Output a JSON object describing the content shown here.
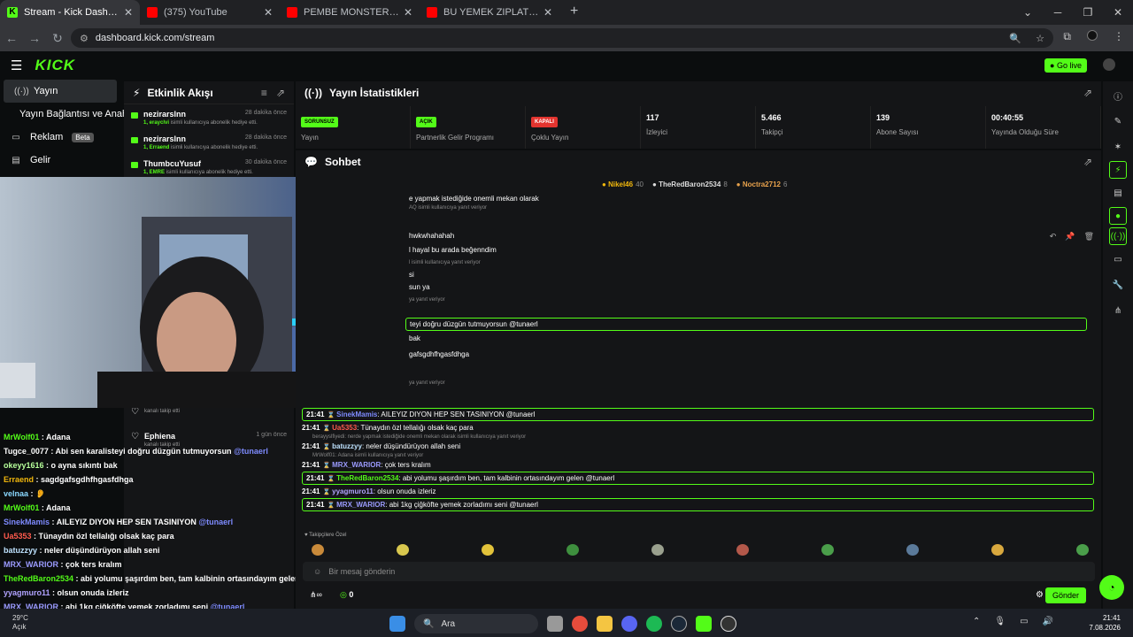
{
  "browser": {
    "tabs": [
      {
        "label": "Stream - Kick Dashboard",
        "icon": "kick-favicon"
      },
      {
        "label": "(375) YouTube",
        "icon": "youtube-favicon"
      },
      {
        "label": "PEMBE MONSTER | Madara Olu...",
        "icon": "youtube-favicon"
      },
      {
        "label": "BU YEMEK ZIPLATIRI ELRAEN, E...",
        "icon": "youtube-favicon"
      }
    ],
    "url": "dashboard.kick.com/stream"
  },
  "header": {
    "logo": "KICK",
    "go_live": "Go live"
  },
  "sidebar": {
    "items": [
      {
        "label": "Yayın",
        "icon": "broadcast-icon"
      },
      {
        "label": "Yayın Bağlantısı ve Anahtarı",
        "icon": ""
      },
      {
        "label": "Reklam",
        "badge": "Beta",
        "icon": "ad-icon"
      },
      {
        "label": "Gelir",
        "icon": "revenue-icon"
      }
    ]
  },
  "activity": {
    "title": "Etkinlik Akışı",
    "events": [
      {
        "name": "nezirarslnn",
        "user": "1, erayclvi",
        "desc": " isimli kullanıcıya abonelik hediye etti.",
        "time": "28 dakika önce"
      },
      {
        "name": "nezirarslnn",
        "user": "1, Erraend",
        "desc": " isimli kullanıcıya abonelik hediye etti.",
        "time": "28 dakika önce"
      },
      {
        "name": "ThumbcuYusuf",
        "user": "1, EMRE",
        "desc": " isimli kullanıcıya abonelik hediye etti.",
        "time": "30 dakika önce"
      }
    ],
    "follow_events": [
      {
        "name": "",
        "desc": "kanalı takip etti",
        "time": ""
      },
      {
        "name": "Ephiena",
        "desc": "kanalı takip etti",
        "time": "1 gün önce"
      }
    ]
  },
  "stats": {
    "title": "Yayın İstatistikleri",
    "items": [
      {
        "badge": "SORUNSUZ",
        "label": "Yayın",
        "type": "ok"
      },
      {
        "badge": "AÇIK",
        "label": "Partnerlik Gelir Programı",
        "type": "ok"
      },
      {
        "badge": "KAPALI",
        "label": "Çoklu Yayın",
        "type": "off"
      },
      {
        "value": "117",
        "label": "İzleyici"
      },
      {
        "value": "5.466",
        "label": "Takipçi"
      },
      {
        "value": "139",
        "label": "Abone Sayısı"
      },
      {
        "value": "00:40:55",
        "label": "Yayında Olduğu Süre"
      }
    ]
  },
  "chat": {
    "title": "Sohbet",
    "pinned": [
      {
        "name": "Nikel46",
        "count": "40",
        "color": "#f2b80c"
      },
      {
        "name": "TheRedBaron2534",
        "count": "8",
        "color": "#dddddd"
      },
      {
        "name": "Noctra2712",
        "count": "6",
        "color": "#e8a24c"
      }
    ],
    "hidden_lines": [
      {
        "text": "e yapmak istediğide onemli mekan olarak",
        "kind": "msg"
      },
      {
        "text": "AQ isimli kullanıcıya yanıt veriyor",
        "kind": "reply"
      },
      {
        "text": "hwkwhahahah",
        "kind": "msg"
      },
      {
        "text": "l hayal bu arada beğenndim",
        "kind": "msg"
      },
      {
        "text": "l isimli kullanıcıya yanıt veriyor",
        "kind": "reply"
      },
      {
        "text": "si",
        "kind": "msg"
      },
      {
        "text": "sun ya",
        "kind": "msg"
      },
      {
        "text": "ya yanıt veriyor",
        "kind": "reply"
      },
      {
        "text": "teyi doğru düzgün tutmuyorsun @tunaerl",
        "kind": "hl"
      },
      {
        "text": "bak",
        "kind": "msg"
      },
      {
        "text": "gafsgdhfhgasfdhga",
        "kind": "msg"
      },
      {
        "text": "ya yanıt veriyor",
        "kind": "reply"
      }
    ],
    "messages": [
      {
        "time": "21:41",
        "user": "SinekMamis",
        "color": "#7e8bff",
        "text": ": AILEYIZ DIYON HEP SEN TASINIYON @tunaerl",
        "hl": true
      },
      {
        "time": "21:41",
        "user": "Ua5353",
        "color": "#ff5b4d",
        "text": ": Tünaydın özl tellalığı olsak kaç para",
        "hl": false
      },
      {
        "reply": "berayyslfiyedi: nerde yapmak istediğide onemli mekan olarak isimli kullanıcıya yanıt veriyor"
      },
      {
        "time": "21:41",
        "user": "batuzzyy",
        "color": "#bfe3ff",
        "text": ": neler düşündürüyon allah seni",
        "hl": false
      },
      {
        "reply": "MrWolf01: Adana isimli kullanıcıya yanıt veriyor"
      },
      {
        "time": "21:41",
        "user": "MRX_WARIOR",
        "color": "#9b9bff",
        "text": ": çok ters kralım",
        "hl": false
      },
      {
        "time": "21:41",
        "user": "TheRedBaron2534",
        "color": "#53fc18",
        "text": ": abi yolumu şaşırdım ben, tam kalbinin ortasındayım gelen @tunaerl",
        "hl": true
      },
      {
        "time": "21:41",
        "user": "yyagmuro11",
        "color": "#b1a3ff",
        "text": ": olsun onuda izleriz",
        "hl": false
      },
      {
        "time": "21:41",
        "user": "MRX_WARIOR",
        "color": "#9b9bff",
        "text": ": abi 1kg çiğköfte yemek zorladımı seni @tunaerl",
        "hl": true
      }
    ],
    "followers_label": "♥ Takipçilere Özel",
    "input_placeholder": "Bir mesaj gönderin",
    "points": "0",
    "send": "Gönder"
  },
  "obs_chat": [
    {
      "user": "MrWolf01",
      "color": "#53fc18",
      "text": " : Adana"
    },
    {
      "user": "Tugce_0077",
      "color": "#ffffff",
      "text": " : Abi sen karalisteyi doğru düzgün tutmuyorsun",
      "mention": " @tunaerl"
    },
    {
      "user": "okeyy1616",
      "color": "#b6ff9a",
      "text": " : o ayna sıkıntı bak"
    },
    {
      "user": "Erraend",
      "color": "#f2b80c",
      "text": " : sagdgafsgdhfhgasfdhga"
    },
    {
      "user": "velnaa",
      "color": "#8ad8ff",
      "text": " : 👂"
    },
    {
      "user": "MrWolf01",
      "color": "#53fc18",
      "text": " : Adana"
    },
    {
      "user": "SinekMamis",
      "color": "#7e8bff",
      "text": " : AILEYIZ DIYON HEP SEN TASINIYON",
      "mention": " @tunaerl"
    },
    {
      "user": "Ua5353",
      "color": "#ff5b4d",
      "text": " : Tünaydın özl tellalığı olsak kaç para"
    },
    {
      "user": "batuzzyy",
      "color": "#bfe3ff",
      "text": " : neler düşündürüyon allah seni"
    },
    {
      "user": "MRX_WARIOR",
      "color": "#9b9bff",
      "text": " : çok ters kralım"
    },
    {
      "user": "TheRedBaron2534",
      "color": "#53fc18",
      "text": " : abi yolumu şaşırdım ben, tam kalbinin ortasındayım gelen",
      "mention": " @tunaerl"
    },
    {
      "user": "yyagmuro11",
      "color": "#b1a3ff",
      "text": " : olsun onuda izleriz"
    },
    {
      "user": "MRX_WARIOR",
      "color": "#9b9bff",
      "text": " : abi 1kg çiğköfte yemek zorladımı seni",
      "mention": " @tunaerl"
    }
  ],
  "taskbar": {
    "search": "Ara",
    "weather_temp": "29°C",
    "weather_desc": "Açık",
    "time": "21:41",
    "date": "7.08.2026"
  },
  "colors": {
    "accent": "#53fc18",
    "bg": "#0b0d0e",
    "panel": "#141517"
  }
}
